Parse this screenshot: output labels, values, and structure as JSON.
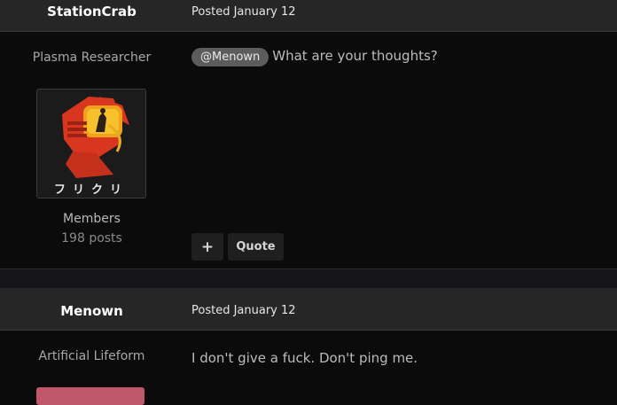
{
  "posts": [
    {
      "author": "StationCrab",
      "date": "Posted January 12",
      "title": "Plasma Researcher",
      "group": "Members",
      "post_count": "198 posts",
      "mention": "@Menown",
      "body": "What are your thoughts?",
      "avatar_caption": "フリクリ",
      "actions": {
        "plus": "+",
        "quote": "Quote"
      }
    },
    {
      "author": "Menown",
      "date": "Posted January 12",
      "title": "Artificial Lifeform",
      "body": "I don't give a fuck. Don't ping me."
    }
  ],
  "colors": {
    "header_bg": "#262626",
    "page_bg": "#0b0b0b",
    "mention_bg": "#5c5c5c",
    "avatar_accent": "#c0566a"
  }
}
